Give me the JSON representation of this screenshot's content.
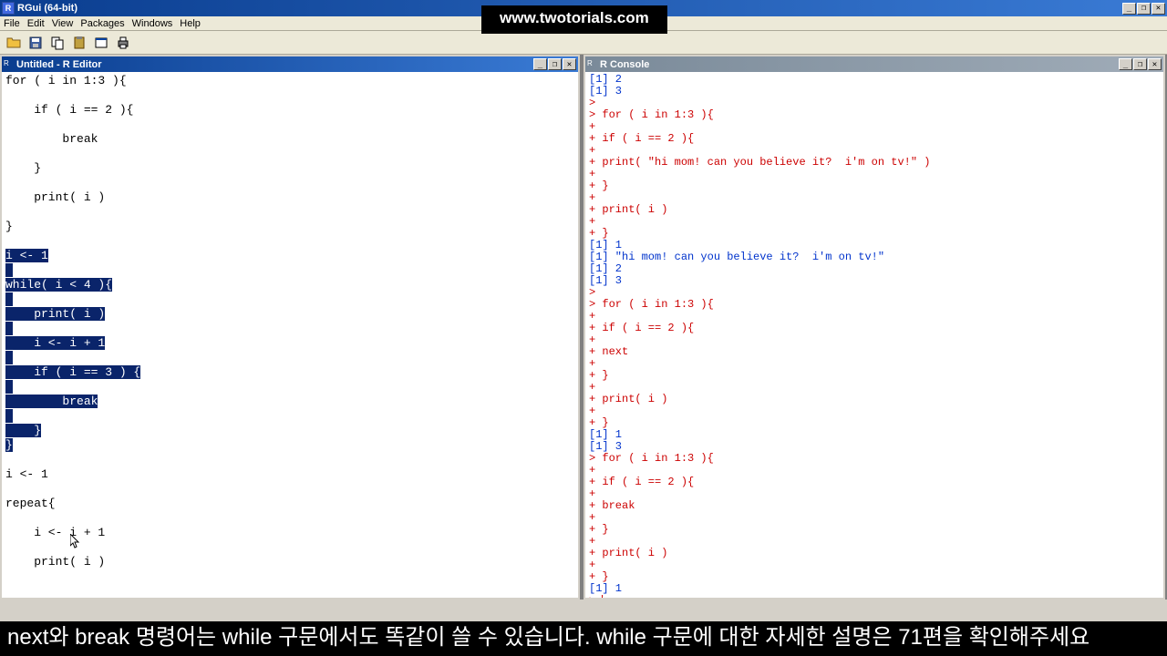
{
  "app": {
    "title": "RGui (64-bit)",
    "icon_letter": "R"
  },
  "menu": [
    "File",
    "Edit",
    "View",
    "Packages",
    "Windows",
    "Help"
  ],
  "toolbar_icons": [
    "open",
    "save",
    "copy",
    "paste",
    "console",
    "print"
  ],
  "editor": {
    "title": "Untitled - R Editor",
    "lines": [
      {
        "t": "for ( i in 1:3 ){",
        "sel": false
      },
      {
        "t": "",
        "sel": false
      },
      {
        "t": "    if ( i == 2 ){",
        "sel": false
      },
      {
        "t": "",
        "sel": false
      },
      {
        "t": "        break",
        "sel": false
      },
      {
        "t": "",
        "sel": false
      },
      {
        "t": "    }",
        "sel": false
      },
      {
        "t": "",
        "sel": false
      },
      {
        "t": "    print( i )",
        "sel": false
      },
      {
        "t": "",
        "sel": false
      },
      {
        "t": "}",
        "sel": false
      },
      {
        "t": "",
        "sel": false
      },
      {
        "t": "i <- 1",
        "sel": true
      },
      {
        "t": "",
        "sel": true
      },
      {
        "t": "while( i < 4 ){",
        "sel": true
      },
      {
        "t": "",
        "sel": true
      },
      {
        "t": "    print( i )",
        "sel": true
      },
      {
        "t": "",
        "sel": true
      },
      {
        "t": "    i <- i + 1",
        "sel": true
      },
      {
        "t": "",
        "sel": true
      },
      {
        "t": "    if ( i == 3 ) {",
        "sel": true
      },
      {
        "t": "",
        "sel": true
      },
      {
        "t": "        break",
        "sel": true
      },
      {
        "t": "",
        "sel": true
      },
      {
        "t": "    }",
        "sel": true
      },
      {
        "t": "}",
        "sel": true
      },
      {
        "t": "",
        "sel": false
      },
      {
        "t": "i <- 1",
        "sel": false
      },
      {
        "t": "",
        "sel": false
      },
      {
        "t": "repeat{",
        "sel": false
      },
      {
        "t": "",
        "sel": false
      },
      {
        "t": "    i <- i + 1",
        "sel": false
      },
      {
        "t": "",
        "sel": false
      },
      {
        "t": "    print( i )",
        "sel": false
      },
      {
        "t": "",
        "sel": false
      }
    ]
  },
  "console": {
    "title": "R Console",
    "lines": [
      {
        "c": "out",
        "t": "[1] 2"
      },
      {
        "c": "out",
        "t": "[1] 3"
      },
      {
        "c": "code",
        "t": "> "
      },
      {
        "c": "code",
        "t": "> for ( i in 1:3 ){"
      },
      {
        "c": "code",
        "t": "+ "
      },
      {
        "c": "code",
        "t": "+ if ( i == 2 ){"
      },
      {
        "c": "code",
        "t": "+ "
      },
      {
        "c": "code",
        "t": "+ print( \"hi mom! can you believe it?  i'm on tv!\" )"
      },
      {
        "c": "code",
        "t": "+ "
      },
      {
        "c": "code",
        "t": "+ }"
      },
      {
        "c": "code",
        "t": "+ "
      },
      {
        "c": "code",
        "t": "+ print( i )"
      },
      {
        "c": "code",
        "t": "+ "
      },
      {
        "c": "code",
        "t": "+ }"
      },
      {
        "c": "out",
        "t": "[1] 1"
      },
      {
        "c": "out",
        "t": "[1] \"hi mom! can you believe it?  i'm on tv!\""
      },
      {
        "c": "out",
        "t": "[1] 2"
      },
      {
        "c": "out",
        "t": "[1] 3"
      },
      {
        "c": "code",
        "t": "> "
      },
      {
        "c": "code",
        "t": "> for ( i in 1:3 ){"
      },
      {
        "c": "code",
        "t": "+ "
      },
      {
        "c": "code",
        "t": "+ if ( i == 2 ){"
      },
      {
        "c": "code",
        "t": "+ "
      },
      {
        "c": "code",
        "t": "+ next"
      },
      {
        "c": "code",
        "t": "+ "
      },
      {
        "c": "code",
        "t": "+ }"
      },
      {
        "c": "code",
        "t": "+ "
      },
      {
        "c": "code",
        "t": "+ print( i )"
      },
      {
        "c": "code",
        "t": "+ "
      },
      {
        "c": "code",
        "t": "+ }"
      },
      {
        "c": "out",
        "t": "[1] 1"
      },
      {
        "c": "out",
        "t": "[1] 3"
      },
      {
        "c": "code",
        "t": "> for ( i in 1:3 ){"
      },
      {
        "c": "code",
        "t": "+ "
      },
      {
        "c": "code",
        "t": "+ if ( i == 2 ){"
      },
      {
        "c": "code",
        "t": "+ "
      },
      {
        "c": "code",
        "t": "+ break"
      },
      {
        "c": "code",
        "t": "+ "
      },
      {
        "c": "code",
        "t": "+ }"
      },
      {
        "c": "code",
        "t": "+ "
      },
      {
        "c": "code",
        "t": "+ print( i )"
      },
      {
        "c": "code",
        "t": "+ "
      },
      {
        "c": "code",
        "t": "+ }"
      },
      {
        "c": "out",
        "t": "[1] 1"
      },
      {
        "c": "code",
        "t": "> "
      }
    ]
  },
  "watermark": "www.twotorials.com",
  "subtitle": "next와 break 명령어는 while 구문에서도 똑같이 쓸 수 있습니다. while 구문에 대한 자세한 설명은 71편을 확인해주세요"
}
